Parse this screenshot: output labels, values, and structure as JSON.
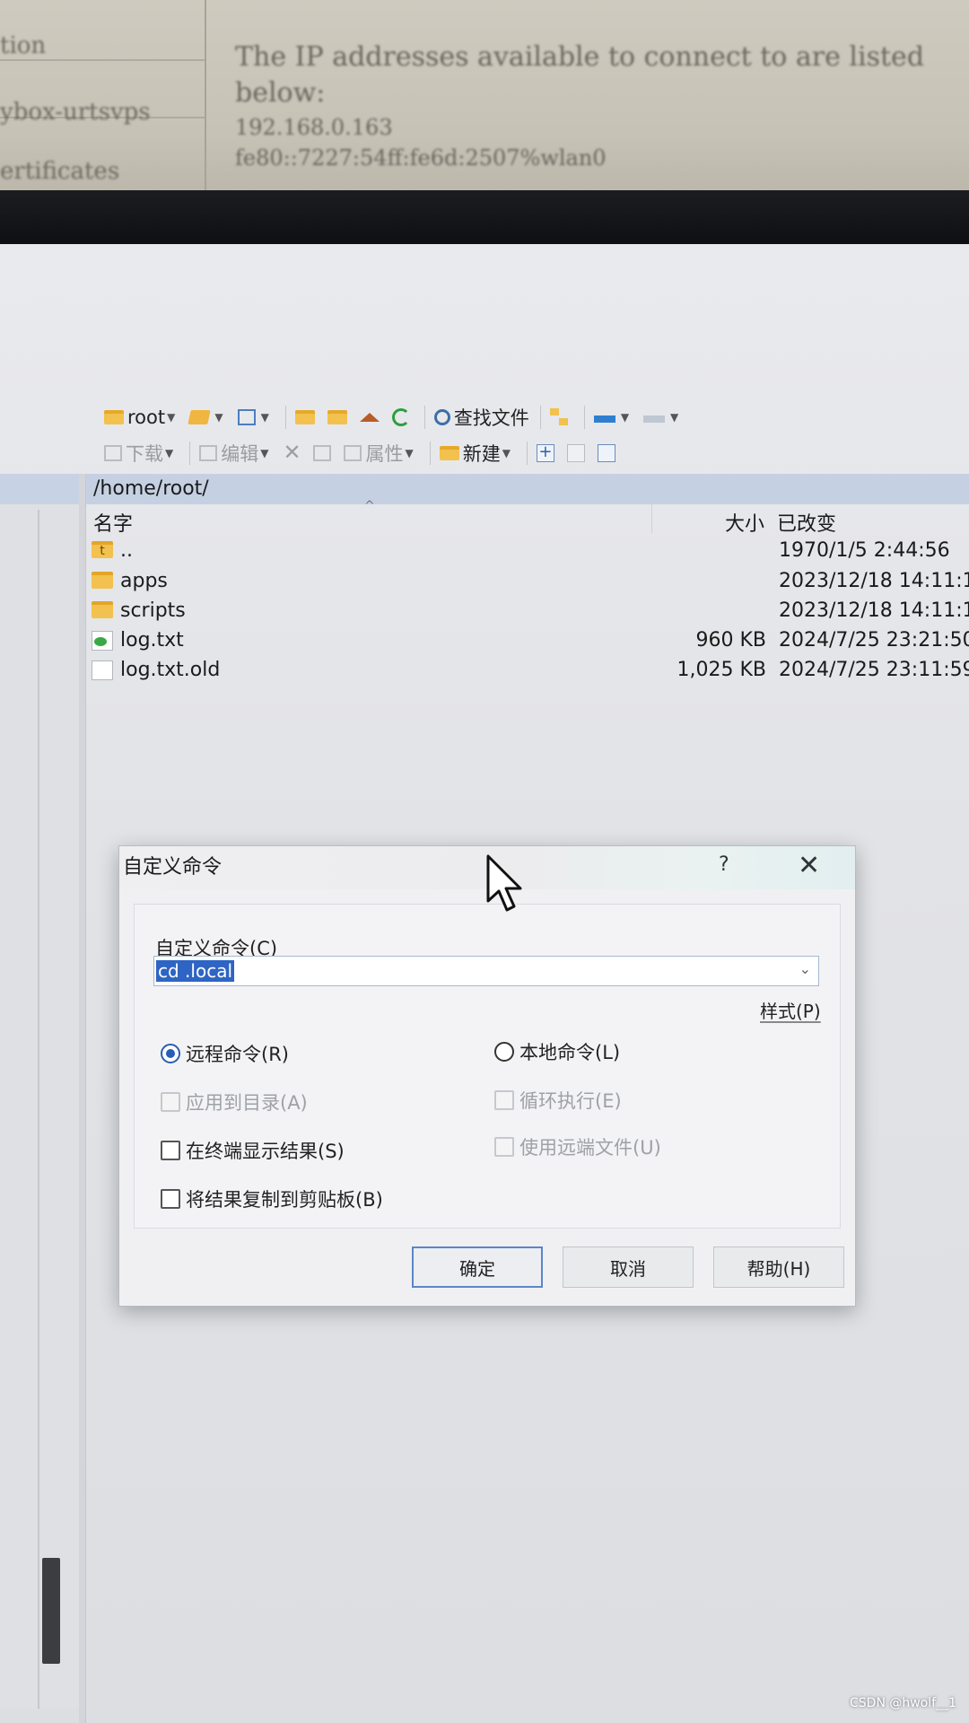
{
  "background_paper": {
    "side_lines": [
      "tion",
      "ybox-urtsvps",
      "ertificates"
    ],
    "body_lines": [
      "The IP addresses available to connect to are listed below:",
      "192.168.0.163",
      "fe80::7227:54ff:fe6d:2507%wlan0"
    ]
  },
  "toolbar": {
    "location_label": "root",
    "find_files_label": "查找文件",
    "download_label": "下载",
    "edit_label": "编辑",
    "properties_label": "属性",
    "new_label": "新建"
  },
  "path_bar": {
    "path": "/home/root/"
  },
  "file_list": {
    "columns": {
      "name": "名字",
      "size": "大小",
      "modified": "已改变"
    },
    "rows": [
      {
        "name": "..",
        "size": "",
        "modified": "1970/1/5 2:44:56",
        "icon": "parent-folder-icon"
      },
      {
        "name": "apps",
        "size": "",
        "modified": "2023/12/18 14:11:1",
        "icon": "folder-icon"
      },
      {
        "name": "scripts",
        "size": "",
        "modified": "2023/12/18 14:11:1",
        "icon": "folder-icon"
      },
      {
        "name": "log.txt",
        "size": "960 KB",
        "modified": "2024/7/25 23:21:50",
        "icon": "text-file-icon"
      },
      {
        "name": "log.txt.old",
        "size": "1,025 KB",
        "modified": "2024/7/25 23:11:59",
        "icon": "file-icon"
      }
    ]
  },
  "dialog": {
    "title": "自定义命令",
    "help_glyph": "?",
    "close_glyph": "✕",
    "command_label": "自定义命令(C)",
    "command_value": "cd .local",
    "style_link": "样式(P)",
    "options": {
      "remote_command": "远程命令(R)",
      "local_command": "本地命令(L)",
      "apply_to_dirs": "应用到目录(A)",
      "loop_execute": "循环执行(E)",
      "show_in_terminal": "在终端显示结果(S)",
      "use_remote_files": "使用远端文件(U)",
      "copy_to_clipboard": "将结果复制到剪贴板(B)"
    },
    "buttons": {
      "ok": "确定",
      "cancel": "取消",
      "help": "帮助(H)"
    }
  },
  "watermark": "CSDN @hwolf__1",
  "colors": {
    "path_bar": "#c5d1e3",
    "selection": "#2e65c4",
    "radio_accent": "#2a5db5"
  }
}
